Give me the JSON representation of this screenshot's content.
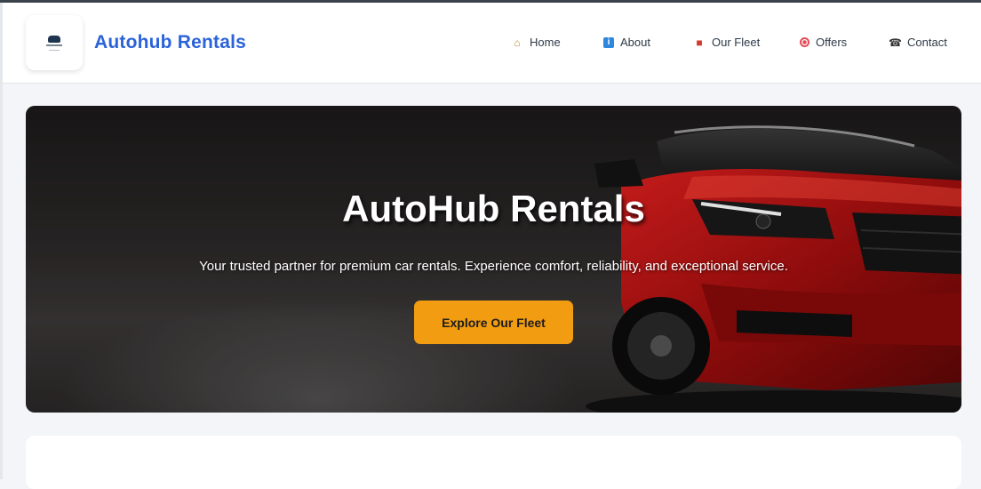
{
  "header": {
    "brand": "Autohub Rentals",
    "nav": [
      {
        "label": "Home",
        "icon": "home-icon"
      },
      {
        "label": "About",
        "icon": "info-icon"
      },
      {
        "label": "Our Fleet",
        "icon": "car-icon"
      },
      {
        "label": "Offers",
        "icon": "target-icon"
      },
      {
        "label": "Contact",
        "icon": "phone-icon"
      }
    ]
  },
  "hero": {
    "title": "AutoHub Rentals",
    "subtitle": "Your trusted partner for premium car rentals. Experience comfort, reliability, and exceptional service.",
    "cta": "Explore Our Fleet"
  },
  "colors": {
    "brand": "#2b63d9",
    "accent": "#f29c11"
  }
}
